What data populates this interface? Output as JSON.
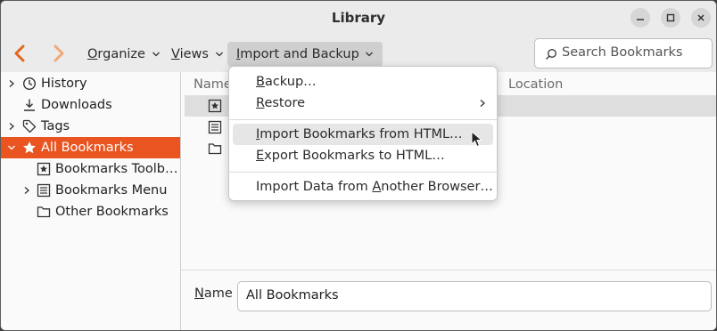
{
  "window": {
    "title": "Library"
  },
  "toolbar": {
    "organize": {
      "underline": "O",
      "rest": "rganize"
    },
    "views": {
      "underline": "V",
      "rest": "iews"
    },
    "import_backup": {
      "underline": "I",
      "rest": "mport and Backup"
    },
    "search_placeholder": "Search Bookmarks"
  },
  "sidebar": {
    "items": [
      {
        "label": "History",
        "icon": "clock-icon"
      },
      {
        "label": "Downloads",
        "icon": "download-icon"
      },
      {
        "label": "Tags",
        "icon": "tag-icon"
      },
      {
        "label": "All Bookmarks",
        "icon": "star-icon",
        "selected": true
      },
      {
        "label": "Bookmarks Toolb…",
        "icon": "bookmark-toolbar-icon"
      },
      {
        "label": "Bookmarks Menu",
        "icon": "bookmarks-menu-icon"
      },
      {
        "label": "Other Bookmarks",
        "icon": "folder-icon"
      }
    ]
  },
  "content": {
    "columns": {
      "name": "Name",
      "location": "Location"
    }
  },
  "details": {
    "name_label": {
      "underline": "N",
      "rest": "ame"
    },
    "name_value": "All Bookmarks"
  },
  "menu": {
    "backup": {
      "underline": "B",
      "rest": "ackup…"
    },
    "restore": {
      "underline": "R",
      "rest": "estore"
    },
    "import_html": {
      "underline": "I",
      "rest": "mport Bookmarks from HTML…"
    },
    "export_html": {
      "underline": "E",
      "rest": "xport Bookmarks to HTML…"
    },
    "import_data": {
      "before": "Import Data from ",
      "underline": "A",
      "rest": "nother Browser…"
    }
  },
  "colors": {
    "accent": "#e95420",
    "back_arrow": "#e2661c",
    "forward_arrow": "#f0a878"
  }
}
